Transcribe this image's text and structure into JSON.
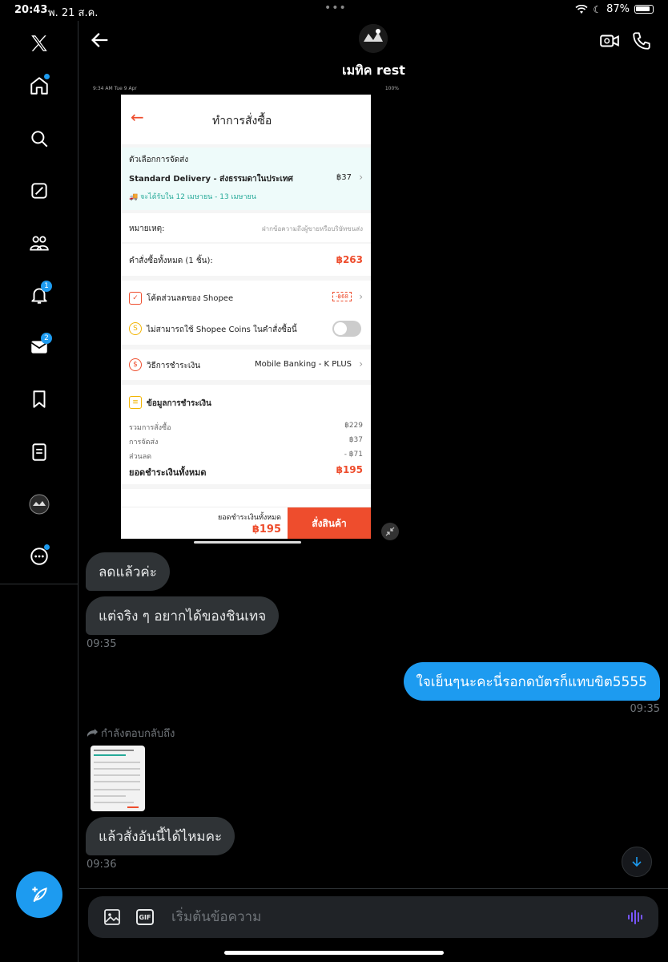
{
  "status_bar": {
    "time": "20:43",
    "date": "พ. 21 ส.ค.",
    "battery": "87%"
  },
  "sidebar": {
    "items": [
      {
        "name": "x-logo"
      },
      {
        "name": "home",
        "dot": true
      },
      {
        "name": "explore"
      },
      {
        "name": "grok"
      },
      {
        "name": "communities"
      },
      {
        "name": "notifications",
        "badge": "1"
      },
      {
        "name": "messages",
        "badge": "2"
      },
      {
        "name": "bookmarks"
      },
      {
        "name": "lists"
      },
      {
        "name": "profile"
      },
      {
        "name": "more",
        "dot": true
      }
    ]
  },
  "header": {
    "name": "เมทิค rest"
  },
  "attachment": {
    "mini_status": {
      "time": "9:34 AM",
      "date": "Tue 9 Apr",
      "battery": "100%"
    },
    "title": "ทำการสั่งซื้อ",
    "shipping": {
      "label": "ตัวเลือกการจัดส่ง",
      "method": "Standard Delivery - ส่งธรรมดาในประเทศ",
      "price": "฿37",
      "eta": "จะได้รับใน 12 เมษายน - 13 เมษายน"
    },
    "note_label": "หมายเหตุ:",
    "note_placeholder": "ฝากข้อความถึงผู้ขายหรือบริษัทขนส่ง",
    "order_total_label": "คำสั่งซื้อทั้งหมด (1 ชิ้น):",
    "order_total": "฿263",
    "voucher_label": "โค้ดส่วนลดของ Shopee",
    "voucher_value": "-฿68",
    "coins_label": "ไม่สามารถใช้ Shopee Coins ในคำสั่งซื้อนี้",
    "payment_label": "วิธีการชำระเงิน",
    "payment_value": "Mobile Banking - K PLUS",
    "payment_info_title": "ข้อมูลการชำระเงิน",
    "rows": [
      {
        "label": "รวมการสั่งซื้อ",
        "value": "฿229"
      },
      {
        "label": "การจัดส่ง",
        "value": "฿37"
      },
      {
        "label": "ส่วนลด",
        "value": "- ฿71"
      }
    ],
    "grand_total_label": "ยอดชำระเงินทั้งหมด",
    "grand_total": "฿195",
    "bottom_total_label": "ยอดชำระเงินทั้งหมด",
    "bottom_total": "฿195",
    "order_button": "สั่งสินค้า"
  },
  "messages": [
    {
      "text": "ลดแล้วค่ะ"
    },
    {
      "text": "แต่จริง ๆ อยากได้ของชินเทจ"
    },
    {
      "time": "09:35"
    },
    {
      "text": "ใจเย็นๆนะคะนี่รอกดบัตรก็แทบขิต5555"
    },
    {
      "time": "09:35"
    },
    {
      "reply": "กำลังตอบกลับถึง"
    },
    {
      "text": "แล้วสั่งอันนี้ได้ไหมคะ"
    },
    {
      "time": "09:36"
    }
  ],
  "composer": {
    "placeholder": "เริ่มต้นข้อความ",
    "gif": "GIF"
  }
}
